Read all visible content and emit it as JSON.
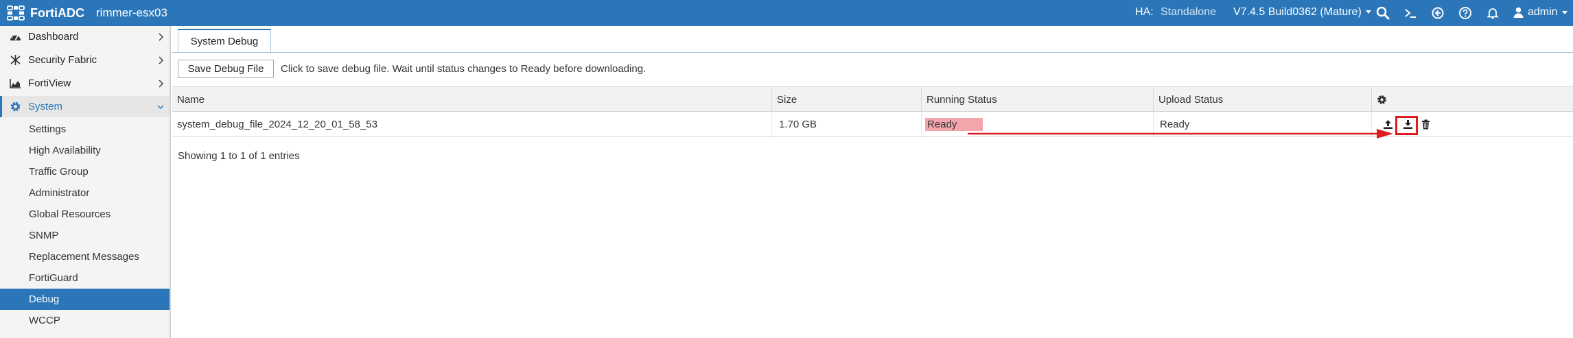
{
  "app": {
    "brand": "FortiADC",
    "hostname": "rimmer-esx03"
  },
  "topbar": {
    "ha_label": "HA:",
    "ha_value": "Standalone",
    "version": "V7.4.5 Build0362 (Mature)",
    "user": "admin",
    "icons": [
      "search-icon",
      "cli-console-icon",
      "logout-icon",
      "help-icon",
      "notification-bell-icon",
      "user-icon"
    ]
  },
  "sidebar": {
    "items": [
      {
        "label": "Dashboard",
        "icon": "dashboard-icon"
      },
      {
        "label": "Security Fabric",
        "icon": "security-fabric-icon"
      },
      {
        "label": "FortiView",
        "icon": "fortiview-chart-icon"
      },
      {
        "label": "System",
        "icon": "gear-icon"
      }
    ],
    "system_children": [
      "Settings",
      "High Availability",
      "Traffic Group",
      "Administrator",
      "Global Resources",
      "SNMP",
      "Replacement Messages",
      "FortiGuard",
      "Debug",
      "WCCP"
    ],
    "active_child": "Debug"
  },
  "main": {
    "tab_label": "System Debug",
    "save_button": "Save Debug File",
    "hint": "Click to save debug file. Wait until status changes to Ready before downloading.",
    "columns": [
      "Name",
      "Size",
      "Running Status",
      "Upload Status"
    ],
    "rows": [
      {
        "name": "system_debug_file_2024_12_20_01_58_53",
        "size": "1.70 GB",
        "running_status": "Ready",
        "upload_status": "Ready"
      }
    ],
    "footer": "Showing 1 to 1 of 1 entries"
  },
  "colors": {
    "topbar": "#2b76b9",
    "active_nav": "#2b76b9",
    "ready_highlight": "#f4a6ad",
    "annotation_red": "#e01c1c"
  }
}
